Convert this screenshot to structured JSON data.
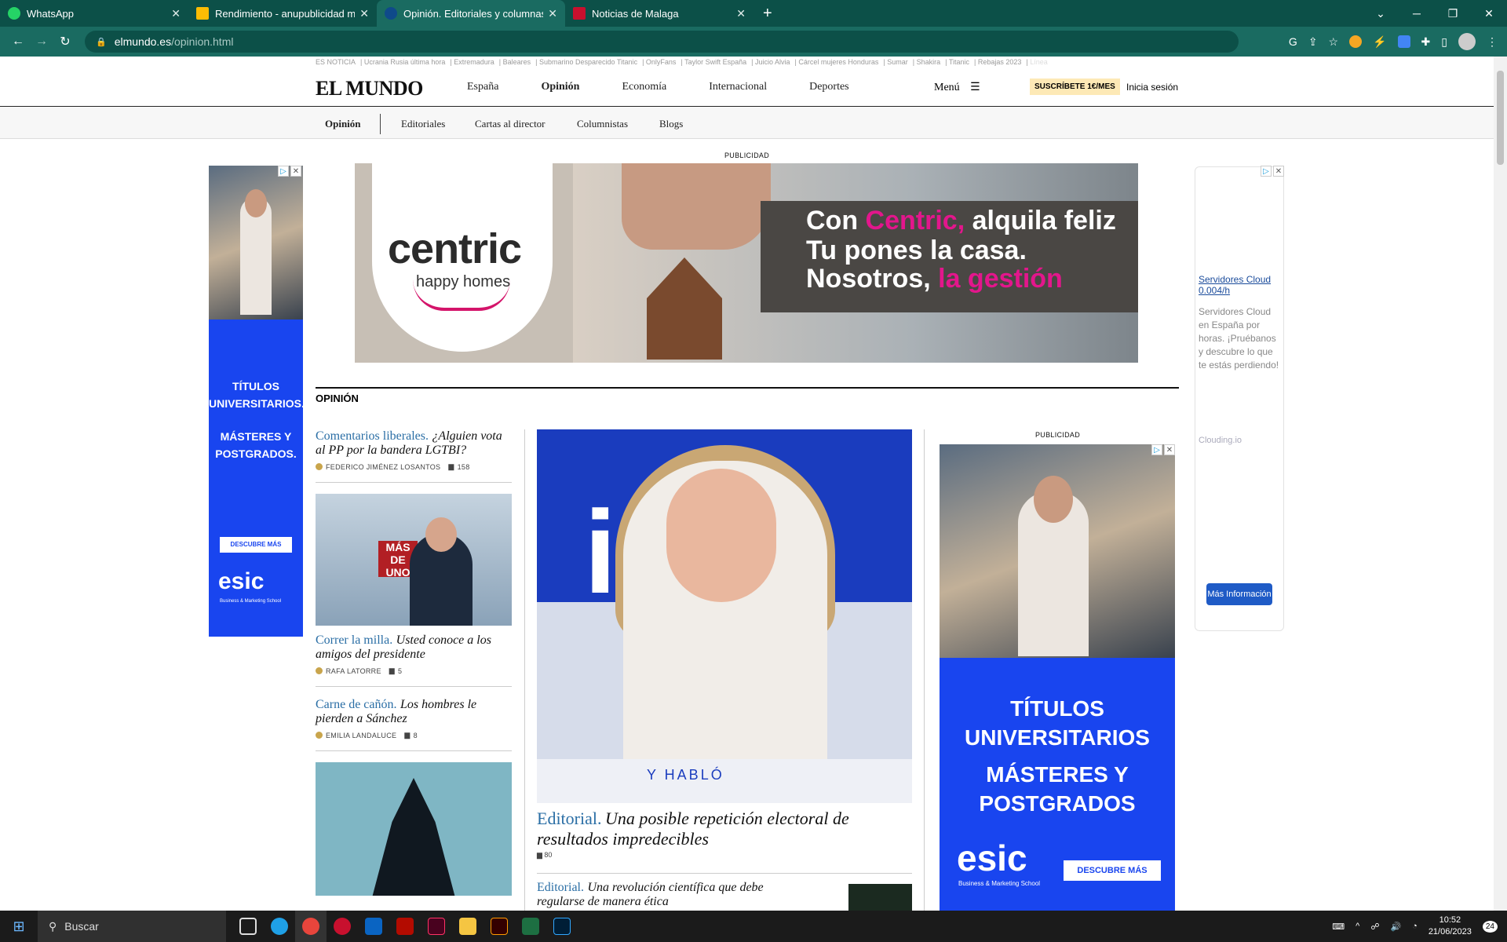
{
  "browser": {
    "tabs": [
      {
        "title": "WhatsApp",
        "color": "#25d366"
      },
      {
        "title": "Rendimiento - anupublicidad mc",
        "color": "#fbbc04"
      },
      {
        "title": "Opinión. Editoriales y columnas |",
        "color": "#1a6b61"
      },
      {
        "title": "Noticias de Malaga",
        "color": "#c8102e"
      }
    ],
    "url_domain": "elmundo.es",
    "url_path": "/opinion.html"
  },
  "site": {
    "trending_label": "ES NOTICIA",
    "trending": [
      "Ucrania Rusia última hora",
      "Extremadura",
      "Baleares",
      "Submarino Desparecido Titanic",
      "OnlyFans",
      "Taylor Swift España",
      "Juicio Alvia",
      "Cárcel mujeres Honduras",
      "Sumar",
      "Shakira",
      "Titanic",
      "Rebajas 2023",
      "Línea"
    ],
    "logo": "EL MUNDO",
    "nav": [
      "España",
      "Opinión",
      "Economía",
      "Internacional",
      "Deportes"
    ],
    "menu": "Menú",
    "subscribe": "SUSCRÍBETE 1€/MES",
    "login": "Inicia sesión",
    "subnav": [
      "Opinión",
      "Editoriales",
      "Cartas al director",
      "Columnistas",
      "Blogs"
    ],
    "ad_label": "PUBLICIDAD"
  },
  "banner": {
    "brand": "centric",
    "tagline": "happy homes",
    "line1_a": "Con ",
    "line1_b": "Centric,",
    "line1_c": " alquila feliz",
    "line2": "Tu pones la casa.",
    "line3_a": "Nosotros, ",
    "line3_b": "la gestión"
  },
  "section": "OPINIÓN",
  "left_articles": [
    {
      "kicker": "Comentarios liberales.",
      "headline": "¿Alguien vota al PP por la bandera LGTBI?",
      "author": "FEDERICO JIMÉNEZ LOSANTOS",
      "comments": "158"
    },
    {
      "kicker": "Correr la milla.",
      "headline": "Usted conoce a los amigos del presidente",
      "author": "RAFA LATORRE",
      "comments": "5"
    },
    {
      "kicker": "Carne de cañón.",
      "headline": "Los hombres le pierden a Sánchez",
      "author": "EMILIA LANDALUCE",
      "comments": "8"
    }
  ],
  "thumb_badge": "MÁS DE UNO",
  "main_article": {
    "kicker": "Editorial.",
    "headline": "Una posible repetición electoral de resultados impredecibles",
    "comments": "80",
    "podium": "Y HABLÓ"
  },
  "second_article": {
    "kicker": "Editorial.",
    "headline": "Una revolución científica que debe regularse de manera ética"
  },
  "esic_ad": {
    "line1": "TÍTULOS UNIVERSITARIOS",
    "line2": "MÁSTERES Y POSTGRADOS",
    "left_line1": "TÍTULOS UNIVERSITARIOS.",
    "left_line2": "MÁSTERES Y POSTGRADOS.",
    "cta": "DESCUBRE MÁS",
    "brand": "esic",
    "brand_sub": "Business & Marketing School"
  },
  "cloud_ad": {
    "title": "Servidores Cloud 0.004/h",
    "desc": "Servidores Cloud en España por horas. ¡Pruébanos y descubre lo que te estás perdiendo!",
    "source": "Clouding.io",
    "cta": "Más Información"
  },
  "taskbar": {
    "search": "Buscar",
    "time": "10:52",
    "date": "21/06/2023",
    "notif": "24"
  }
}
